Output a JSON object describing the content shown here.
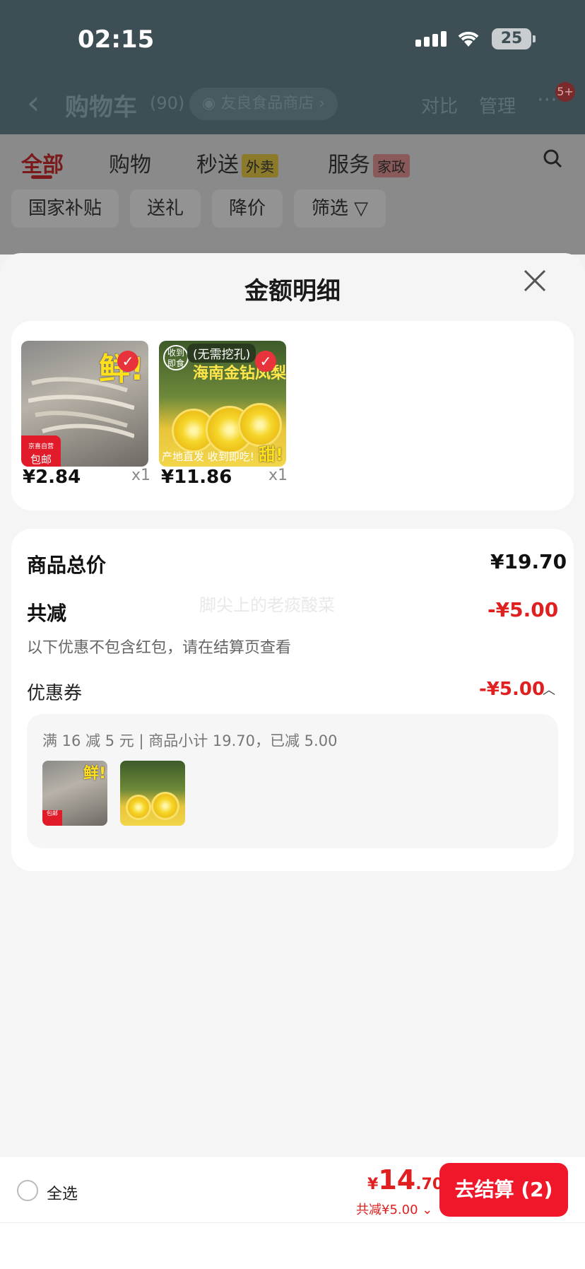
{
  "status_bar": {
    "time": "02:15",
    "battery": "25"
  },
  "nav": {
    "title": "购物车",
    "count": "(90)",
    "store": "友良食品商店",
    "compare": "对比",
    "manage": "管理",
    "more_badge": "5+"
  },
  "tabs": [
    {
      "label": "全部"
    },
    {
      "label": "购物"
    },
    {
      "label": "秒送",
      "tag": "外卖"
    },
    {
      "label": "服务",
      "tag": "家政"
    }
  ],
  "filters": [
    "国家补贴",
    "送礼",
    "降价",
    "筛选"
  ],
  "sheet": {
    "title": "金额明细",
    "items": [
      {
        "price": "¥2.84",
        "qty": "x1",
        "fresh": "鲜!",
        "tag": "京喜自营",
        "tag2": "包邮"
      },
      {
        "price": "¥11.86",
        "qty": "x1",
        "banner": "(无需挖孔)",
        "title": "海南金钻凤梨",
        "badge": "收到即食",
        "bottom": "产地直发 收到即吃!",
        "sweet": "甜!"
      }
    ],
    "summary": {
      "total_label": "商品总价",
      "total_value": "¥19.70",
      "reduce_label": "共减",
      "reduce_value": "-¥5.00",
      "note": "以下优惠不包含红包，请在结算页查看",
      "watermark": "脚尖上的老痰酸菜",
      "coupon_label": "优惠券",
      "coupon_value": "-¥5.00",
      "coupon_detail": "满 16 减 5 元 | 商品小计 19.70，已减 5.00"
    }
  },
  "bottom": {
    "select_all": "全选",
    "currency": "¥",
    "total_int": "14",
    "total_dec": ".70",
    "reduce": "共减¥5.00",
    "checkout": "去结算 (2)"
  }
}
